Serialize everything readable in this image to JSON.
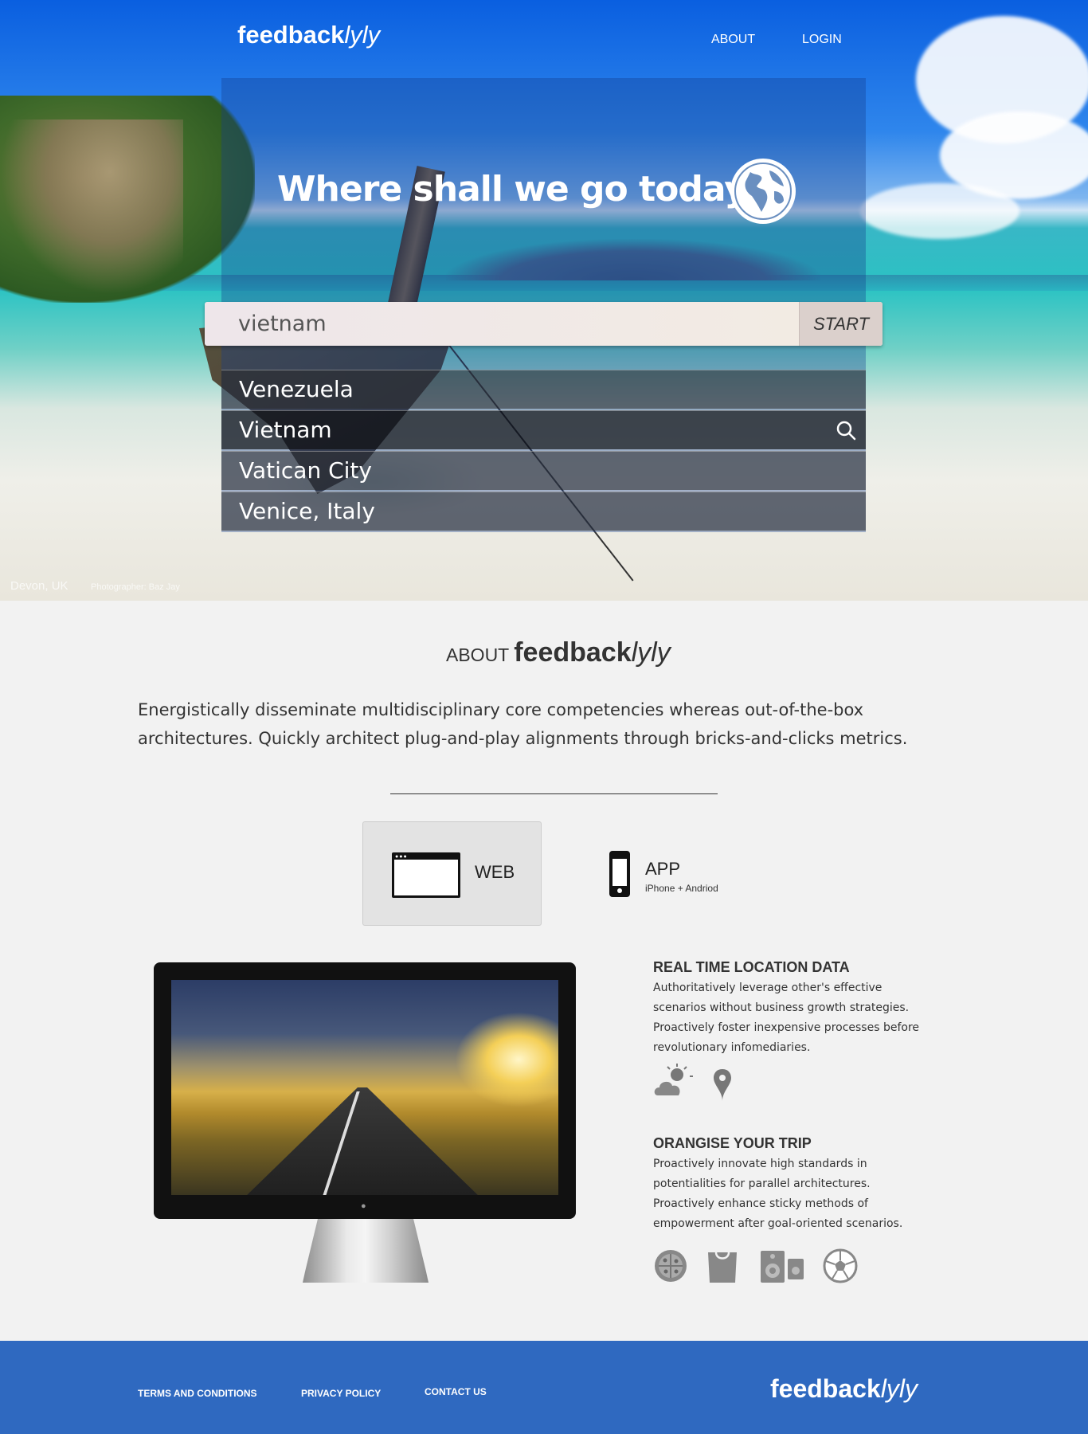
{
  "brand": {
    "bold": "feedback",
    "italic": "lyly"
  },
  "nav": {
    "about": "ABOUT",
    "login": "LOGIN"
  },
  "hero": {
    "headline": "Where shall we go today?",
    "search_value": "vietnam",
    "start_label": "START",
    "suggestions": [
      "Venezuela",
      "Vietnam",
      "Vatican City",
      "Venice, Italy"
    ],
    "active_suggestion": "Vietnam",
    "photo_place": "Devon, UK",
    "photo_credit": "Photographer: Baz Jay"
  },
  "about": {
    "title_prefix": "ABOUT",
    "text": "Energistically disseminate multidisciplinary core competencies whereas out-of-the-box architectures. Quickly architect plug-and-play alignments through bricks-and-clicks metrics."
  },
  "tabs": {
    "web": "WEB",
    "app": "APP",
    "app_sub": "iPhone + Andriod"
  },
  "features": [
    {
      "title": "REAL TIME LOCATION DATA",
      "text": "Authoritatively leverage other's effective scenarios without business growth strategies. Proactively foster inexpensive processes before revolutionary infomediaries.",
      "icons": [
        "weather-icon",
        "location-pin-icon"
      ]
    },
    {
      "title": "ORANGISE YOUR TRIP",
      "text": "Proactively innovate high standards in potentialities for parallel architectures. Proactively enhance sticky methods of empowerment after goal-oriented scenarios.",
      "icons": [
        "pizza-icon",
        "shopping-bag-icon",
        "speaker-icon",
        "soccer-ball-icon"
      ]
    }
  ],
  "footer": {
    "terms": "TERMS AND CONDITIONS",
    "privacy": "PRIVACY POLICY",
    "contact": "CONTACT US"
  },
  "colors": {
    "footer": "#2f69c0",
    "hero_sky": "#0a5fe0",
    "text": "#333333"
  }
}
